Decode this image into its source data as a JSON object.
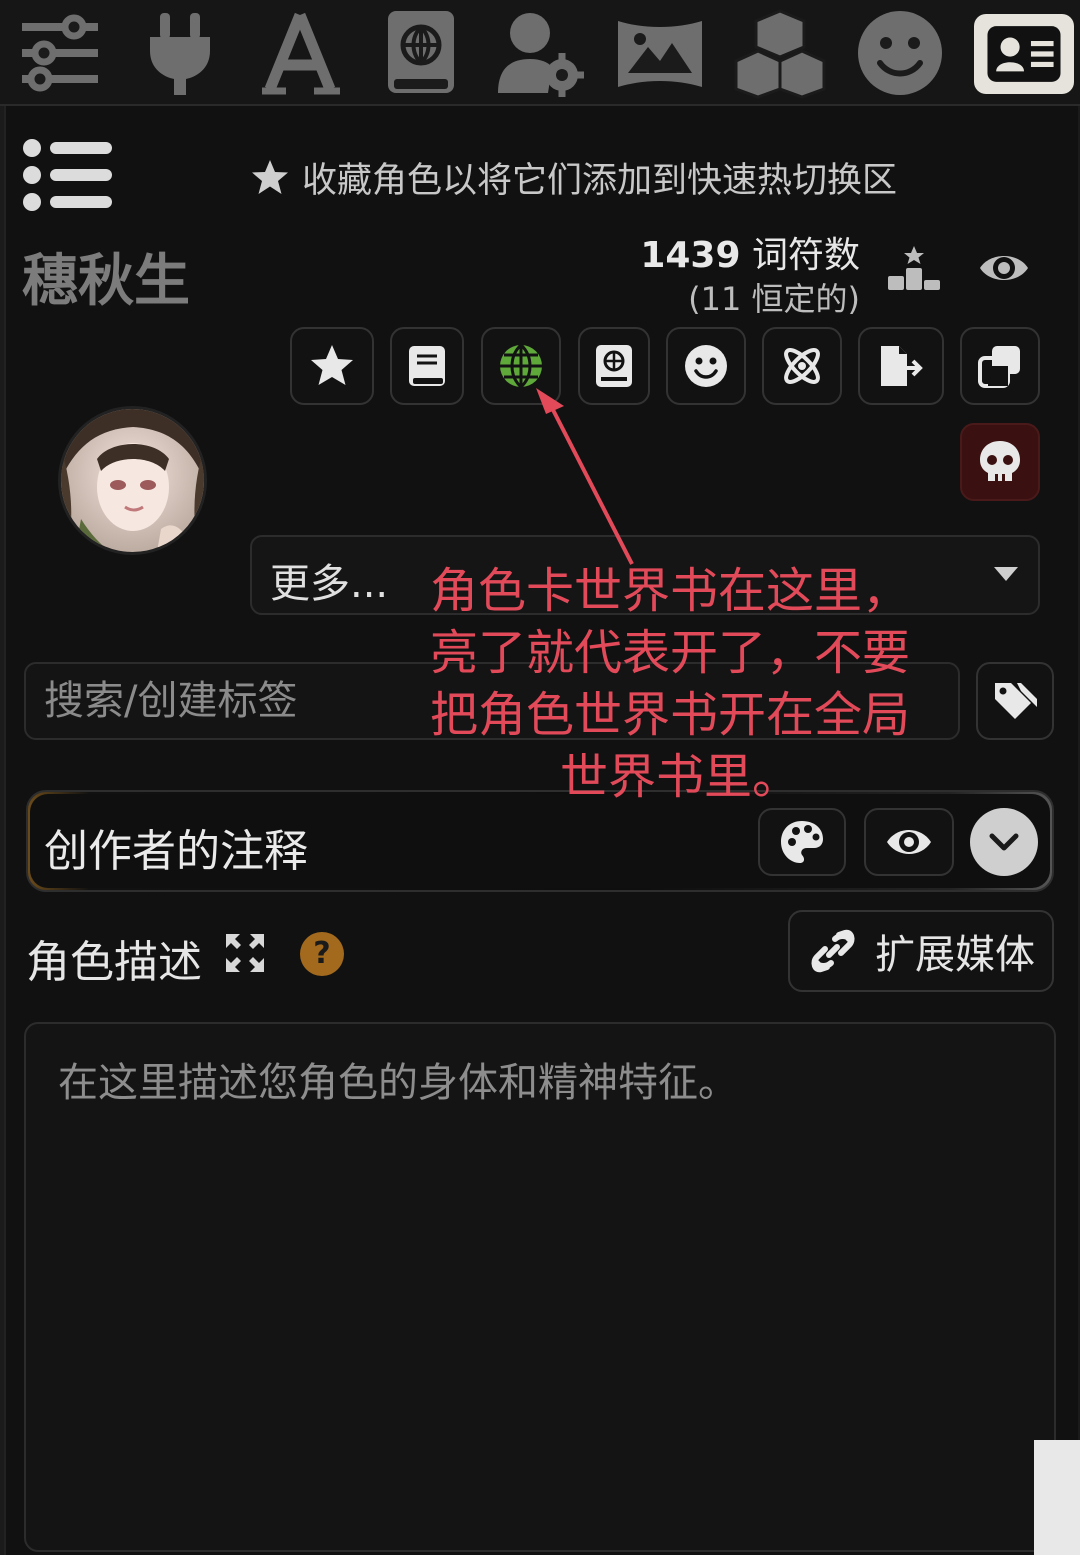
{
  "fav_hint": "收藏角色以将它们添加到快速热切换区",
  "character": {
    "name": "穗秋生",
    "token_count": "1439",
    "token_label": "词符数",
    "permanent": "(11 恒定的)"
  },
  "more_dropdown": {
    "selected": "更多..."
  },
  "tags": {
    "placeholder": "搜索/创建标签"
  },
  "creator_notes": {
    "label": "创作者的注释"
  },
  "description": {
    "label": "角色描述",
    "help": "?",
    "placeholder": "在这里描述您角色的身体和精神特征。"
  },
  "ext_media": {
    "label": "扩展媒体"
  },
  "annotation": {
    "line1": "角色卡世界书在这里，",
    "line2": "亮了就代表开了，不要",
    "line3": "把角色世界书开在全局",
    "line4": "世界书里。"
  },
  "colors": {
    "background": "#111111",
    "icon_gray": "#777777",
    "world_globe_active": "#5fa83a",
    "danger_bg": "#3a1010",
    "annotation_red": "#e24a5a",
    "help_orange": "#a36a1e"
  }
}
